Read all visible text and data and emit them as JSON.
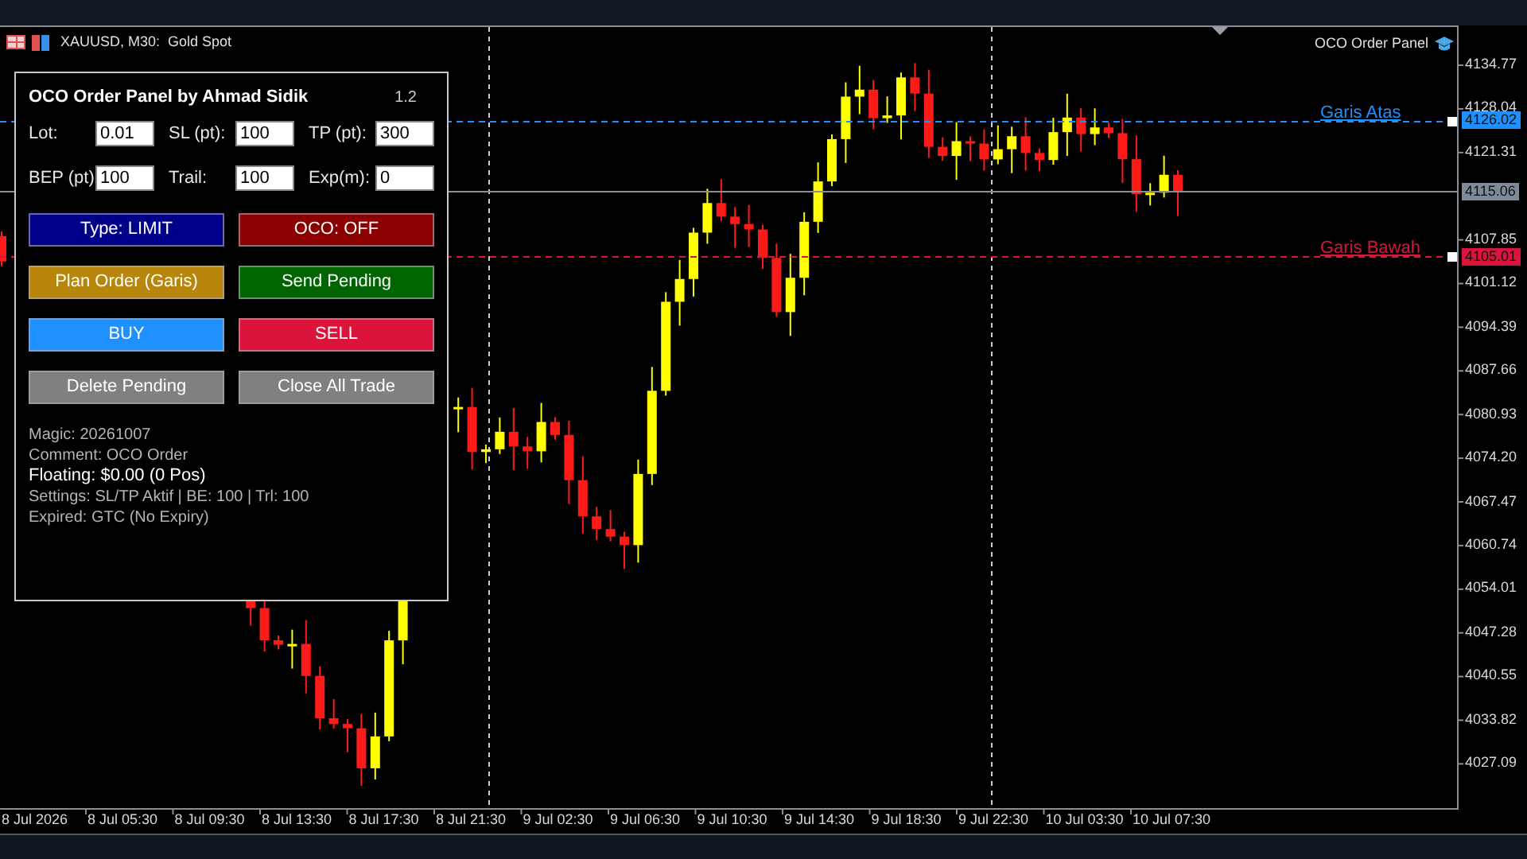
{
  "chart_header": {
    "title": "XAUUSD, M30:  Gold Spot",
    "indicator": "OCO Order Panel"
  },
  "price_axis": [
    "4134.77",
    "4128.04",
    "4121.31",
    "4107.85",
    "4101.12",
    "4094.39",
    "4087.66",
    "4080.93",
    "4074.20",
    "4067.47",
    "4060.74",
    "4054.01",
    "4047.28",
    "4040.55",
    "4033.82",
    "4027.09"
  ],
  "price_tags": [
    {
      "label": "4126.02",
      "color": "#1e90ff"
    },
    {
      "label": "4115.06",
      "color": "#7f8a99"
    },
    {
      "label": "4105.01",
      "color": "#dc143c"
    }
  ],
  "lines": [
    {
      "label": "Garis Atas",
      "color": "#1e90ff"
    },
    {
      "label": "Garis Bawah",
      "color": "#dc143c"
    }
  ],
  "time_axis": [
    "8 Jul 2026",
    "8 Jul 05:30",
    "8 Jul 09:30",
    "8 Jul 13:30",
    "8 Jul 17:30",
    "8 Jul 21:30",
    "9 Jul 02:30",
    "9 Jul 06:30",
    "9 Jul 10:30",
    "9 Jul 14:30",
    "9 Jul 18:30",
    "9 Jul 22:30",
    "10 Jul 03:30",
    "10 Jul 07:30"
  ],
  "panel": {
    "title": "OCO Order Panel by Ahmad Sidik",
    "version": "1.2",
    "fields": [
      {
        "label": "Lot:",
        "value": "0.01"
      },
      {
        "label": "SL (pt):",
        "value": "100"
      },
      {
        "label": "TP (pt):",
        "value": "300"
      },
      {
        "label": "BEP (pt)",
        "value": "100"
      },
      {
        "label": "Trail:",
        "value": "100"
      },
      {
        "label": "Exp(m):",
        "value": "0"
      }
    ],
    "buttons": [
      {
        "label": "Type: LIMIT",
        "color": "#00008b"
      },
      {
        "label": "OCO: OFF",
        "color": "#8b0000"
      },
      {
        "label": "Plan Order (Garis)",
        "color": "#b8860b"
      },
      {
        "label": "Send Pending",
        "color": "#006400"
      },
      {
        "label": "BUY",
        "color": "#1e90ff"
      },
      {
        "label": "SELL",
        "color": "#dc143c"
      },
      {
        "label": "Delete Pending",
        "color": "#808080"
      },
      {
        "label": "Close All Trade",
        "color": "#808080"
      }
    ],
    "info": [
      {
        "text": "Magic: 20261007",
        "kind": "plain"
      },
      {
        "text": "Comment: OCO Order",
        "kind": "plain"
      },
      {
        "text": "Floating: $0.00 (0 Pos)",
        "kind": "bold"
      },
      {
        "text": "Settings: SL/TP Aktif | BE: 100 | Trl: 100",
        "kind": "plain"
      },
      {
        "text": "Expired: GTC (No Expiry)",
        "kind": "plain"
      }
    ]
  }
}
